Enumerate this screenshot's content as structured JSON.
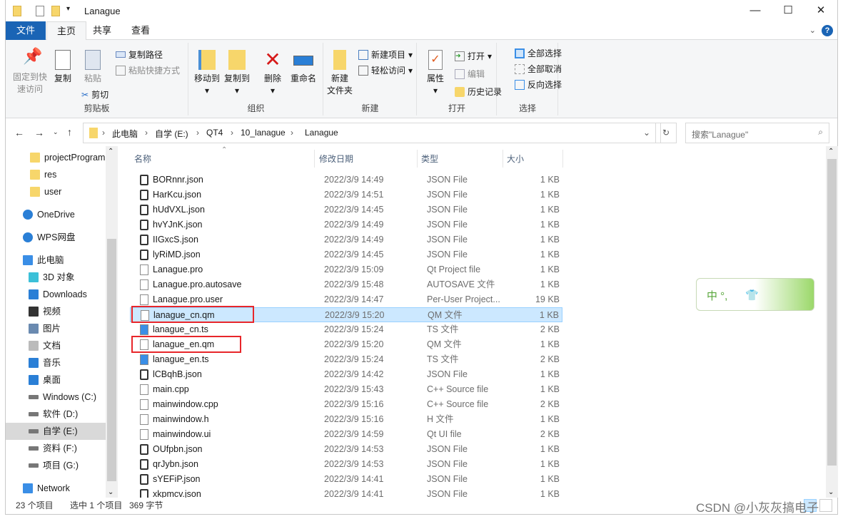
{
  "window": {
    "title": "Lanague",
    "controls": {
      "minimize": "—",
      "maximize": "☐",
      "close": "✕"
    }
  },
  "tabs": [
    {
      "label": "文件"
    },
    {
      "label": "主页"
    },
    {
      "label": "共享"
    },
    {
      "label": "查看"
    }
  ],
  "ribbon": {
    "clipboard": {
      "label": "剪贴板",
      "pin": "固定到快\n速访问",
      "pin1": "固定到快",
      "pin2": "速访问",
      "copy": "复制",
      "paste": "粘贴",
      "copy_path": "复制路径",
      "paste_shortcut": "粘贴快捷方式",
      "cut": "剪切"
    },
    "organize": {
      "label": "组织",
      "move_to": "移动到",
      "copy_to": "复制到",
      "delete": "删除",
      "rename": "重命名"
    },
    "new": {
      "label": "新建",
      "new_folder1": "新建",
      "new_folder2": "文件夹",
      "new_item": "新建项目",
      "easy_access": "轻松访问"
    },
    "open": {
      "label": "打开",
      "properties": "属性",
      "open": "打开",
      "edit": "编辑",
      "history": "历史记录"
    },
    "select": {
      "label": "选择",
      "select_all": "全部选择",
      "select_none": "全部取消",
      "invert": "反向选择"
    }
  },
  "address": {
    "crumbs": [
      "此电脑",
      "自学 (E:)",
      "QT4",
      "10_lanague",
      "Lanague"
    ],
    "search_placeholder": "搜索\"Lanague\""
  },
  "nav": [
    {
      "label": "projectProgram",
      "icon": "folder-icon"
    },
    {
      "label": "res",
      "icon": "folder-icon"
    },
    {
      "label": "user",
      "icon": "folder-icon"
    },
    {
      "label": "OneDrive",
      "icon": "cloud-icon"
    },
    {
      "label": "WPS网盘",
      "icon": "cloud-icon"
    },
    {
      "label": "此电脑",
      "icon": "computer-icon"
    },
    {
      "label": "3D 对象",
      "icon": "cube-icon"
    },
    {
      "label": "Downloads",
      "icon": "download-icon"
    },
    {
      "label": "视频",
      "icon": "video-icon"
    },
    {
      "label": "图片",
      "icon": "picture-icon"
    },
    {
      "label": "文档",
      "icon": "document-icon"
    },
    {
      "label": "音乐",
      "icon": "music-icon"
    },
    {
      "label": "桌面",
      "icon": "desktop-icon"
    },
    {
      "label": "Windows (C:)",
      "icon": "drive-icon"
    },
    {
      "label": "软件 (D:)",
      "icon": "drive-icon"
    },
    {
      "label": "自学 (E:)",
      "icon": "drive-icon",
      "selected": true
    },
    {
      "label": "资料 (F:)",
      "icon": "drive-icon"
    },
    {
      "label": "项目 (G:)",
      "icon": "drive-icon"
    },
    {
      "label": "Network",
      "icon": "network-icon"
    }
  ],
  "columns": {
    "name": "名称",
    "date": "修改日期",
    "type": "类型",
    "size": "大小"
  },
  "files": [
    {
      "name": "BORnnr.json",
      "date": "2022/3/9 14:49",
      "type": "JSON File",
      "size": "1 KB"
    },
    {
      "name": "HarKcu.json",
      "date": "2022/3/9 14:51",
      "type": "JSON File",
      "size": "1 KB"
    },
    {
      "name": "hUdVXL.json",
      "date": "2022/3/9 14:45",
      "type": "JSON File",
      "size": "1 KB"
    },
    {
      "name": "hvYJnK.json",
      "date": "2022/3/9 14:49",
      "type": "JSON File",
      "size": "1 KB"
    },
    {
      "name": "IIGxcS.json",
      "date": "2022/3/9 14:49",
      "type": "JSON File",
      "size": "1 KB"
    },
    {
      "name": "lyRiMD.json",
      "date": "2022/3/9 14:45",
      "type": "JSON File",
      "size": "1 KB"
    },
    {
      "name": "Lanague.pro",
      "date": "2022/3/9 15:09",
      "type": "Qt Project file",
      "size": "1 KB"
    },
    {
      "name": "Lanague.pro.autosave",
      "date": "2022/3/9 15:48",
      "type": "AUTOSAVE 文件",
      "size": "1 KB"
    },
    {
      "name": "Lanague.pro.user",
      "date": "2022/3/9 14:47",
      "type": "Per-User Project...",
      "size": "19 KB"
    },
    {
      "name": "lanague_cn.qm",
      "date": "2022/3/9 15:20",
      "type": "QM 文件",
      "size": "1 KB",
      "selected": true,
      "highlighted": true
    },
    {
      "name": "lanague_cn.ts",
      "date": "2022/3/9 15:24",
      "type": "TS 文件",
      "size": "2 KB"
    },
    {
      "name": "lanague_en.qm",
      "date": "2022/3/9 15:20",
      "type": "QM 文件",
      "size": "1 KB",
      "highlighted": true
    },
    {
      "name": "lanague_en.ts",
      "date": "2022/3/9 15:24",
      "type": "TS 文件",
      "size": "2 KB"
    },
    {
      "name": "lCBqhB.json",
      "date": "2022/3/9 14:42",
      "type": "JSON File",
      "size": "1 KB"
    },
    {
      "name": "main.cpp",
      "date": "2022/3/9 15:43",
      "type": "C++ Source file",
      "size": "1 KB"
    },
    {
      "name": "mainwindow.cpp",
      "date": "2022/3/9 15:16",
      "type": "C++ Source file",
      "size": "2 KB"
    },
    {
      "name": "mainwindow.h",
      "date": "2022/3/9 15:16",
      "type": "H 文件",
      "size": "1 KB"
    },
    {
      "name": "mainwindow.ui",
      "date": "2022/3/9 14:59",
      "type": "Qt UI file",
      "size": "2 KB"
    },
    {
      "name": "OUfpbn.json",
      "date": "2022/3/9 14:53",
      "type": "JSON File",
      "size": "1 KB"
    },
    {
      "name": "qrJybn.json",
      "date": "2022/3/9 14:53",
      "type": "JSON File",
      "size": "1 KB"
    },
    {
      "name": "sYEFiP.json",
      "date": "2022/3/9 14:41",
      "type": "JSON File",
      "size": "1 KB"
    },
    {
      "name": "xkpmcv.json",
      "date": "2022/3/9 14:41",
      "type": "JSON File",
      "size": "1 KB"
    }
  ],
  "status": {
    "count": "23 个项目",
    "selected": "选中 1 个项目",
    "bytes": "369 字节"
  },
  "ime": {
    "text": "中 °,"
  },
  "watermark": "CSDN @小灰灰搞电子",
  "colors": {
    "accent": "#1a64b5",
    "selection": "#cce8ff",
    "highlight_box": "#e8262a"
  }
}
